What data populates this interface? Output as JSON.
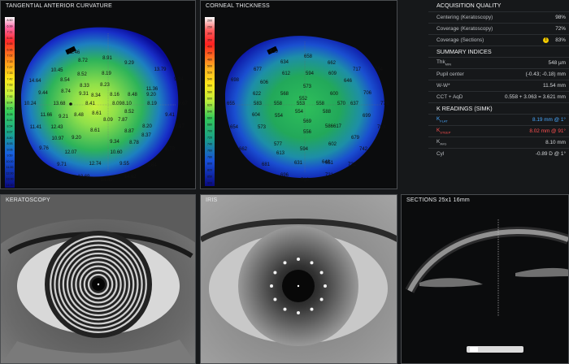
{
  "panels": {
    "tangential": {
      "title": "TANGENTIAL ANTERIOR CURVATURE",
      "scale": [
        "8.50",
        "6.99",
        "7.11",
        "6.44",
        "6.65",
        "6.96",
        "7.02",
        "7.15",
        "7.27",
        "7.33",
        "7.42",
        "7.63",
        "7.79",
        "7.92",
        "8.04",
        "8.15",
        "8.28",
        "8.41",
        "8.54",
        "8.67",
        "8.80",
        "8.93",
        "9.06",
        "9.50",
        "10.00",
        "11.00",
        "12.00",
        "13.00",
        "14.00"
      ],
      "values": [
        {
          "t": "11.46"
        },
        {
          "t": "8.72"
        },
        {
          "t": "8.91"
        },
        {
          "t": "9.29"
        },
        {
          "t": "13.79"
        },
        {
          "t": "10.45"
        },
        {
          "t": "8.54"
        },
        {
          "t": "8.52"
        },
        {
          "t": "8.19"
        },
        {
          "t": "11.36"
        },
        {
          "t": "9.84"
        },
        {
          "t": "14.64"
        },
        {
          "t": "9.44"
        },
        {
          "t": "8.33"
        },
        {
          "t": "8.23"
        },
        {
          "t": "8.74"
        },
        {
          "t": "9.31"
        },
        {
          "t": "8.34"
        },
        {
          "t": "8.16"
        },
        {
          "t": "8.48"
        },
        {
          "t": "9.20"
        },
        {
          "t": "10.24"
        },
        {
          "t": "13.68"
        },
        {
          "t": "8.41"
        },
        {
          "t": "8.09"
        },
        {
          "t": "8.10"
        },
        {
          "t": "8.19"
        },
        {
          "t": "9.67"
        },
        {
          "t": "11.66"
        },
        {
          "t": "9.21"
        },
        {
          "t": "8.61"
        },
        {
          "t": "8.52"
        },
        {
          "t": "9.41"
        },
        {
          "t": "11.41"
        },
        {
          "t": "12.43"
        },
        {
          "t": "8.48"
        },
        {
          "t": "8.09"
        },
        {
          "t": "7.87"
        },
        {
          "t": "8.20"
        },
        {
          "t": "9.17"
        },
        {
          "t": "10.97"
        },
        {
          "t": "9.20"
        },
        {
          "t": "8.61"
        },
        {
          "t": "8.87"
        },
        {
          "t": "8.37"
        },
        {
          "t": "9.76"
        },
        {
          "t": "12.07"
        },
        {
          "t": "9.34"
        },
        {
          "t": "8.78"
        },
        {
          "t": "8.78"
        },
        {
          "t": "10.60"
        },
        {
          "t": "9.71"
        },
        {
          "t": "12.74"
        },
        {
          "t": "9.55"
        },
        {
          "t": "9.64"
        },
        {
          "t": "13.69"
        },
        {
          "t": "14.62"
        },
        {
          "t": "14.42"
        },
        {
          "t": "14.88"
        }
      ]
    },
    "thickness": {
      "title": "CORNEAL THICKNESS",
      "scale": [
        "200",
        "250",
        "300",
        "350",
        "400",
        "450",
        "480",
        "500",
        "520",
        "540",
        "560",
        "580",
        "600",
        "620",
        "640",
        "660",
        "680",
        "700",
        "720",
        "740",
        "760",
        "780",
        "800",
        "820",
        "850",
        "900"
      ],
      "values": [
        {
          "t": "619"
        },
        {
          "t": "658"
        },
        {
          "t": "634"
        },
        {
          "t": "662"
        },
        {
          "t": "717"
        },
        {
          "t": "677"
        },
        {
          "t": "612"
        },
        {
          "t": "594"
        },
        {
          "t": "609"
        },
        {
          "t": "646"
        },
        {
          "t": "754"
        },
        {
          "t": "698"
        },
        {
          "t": "606"
        },
        {
          "t": "573"
        },
        {
          "t": "622"
        },
        {
          "t": "568"
        },
        {
          "t": "552"
        },
        {
          "t": "600"
        },
        {
          "t": "706"
        },
        {
          "t": "655"
        },
        {
          "t": "583"
        },
        {
          "t": "558"
        },
        {
          "t": "553"
        },
        {
          "t": "558"
        },
        {
          "t": "570"
        },
        {
          "t": "637"
        },
        {
          "t": "770"
        },
        {
          "t": "554"
        },
        {
          "t": "588"
        },
        {
          "t": "654"
        },
        {
          "t": "573"
        },
        {
          "t": "554"
        },
        {
          "t": "556"
        },
        {
          "t": "586"
        },
        {
          "t": "699"
        },
        {
          "t": "604"
        },
        {
          "t": "569"
        },
        {
          "t": "617"
        },
        {
          "t": "763"
        },
        {
          "t": "662"
        },
        {
          "t": "577"
        },
        {
          "t": "602"
        },
        {
          "t": "679"
        },
        {
          "t": "613"
        },
        {
          "t": "594"
        },
        {
          "t": "651"
        },
        {
          "t": "742"
        },
        {
          "t": "681"
        },
        {
          "t": "631"
        },
        {
          "t": "648"
        },
        {
          "t": "732"
        },
        {
          "t": "696"
        },
        {
          "t": "716"
        },
        {
          "t": "721"
        }
      ]
    },
    "keratoscopy": {
      "title": "KERATOSCOPY"
    },
    "iris": {
      "title": "IRIS"
    },
    "sections": {
      "title": "SECTIONS 25x1 16mm"
    }
  },
  "acquisition": {
    "title": "ACQUISITION QUALITY",
    "rows": [
      {
        "label": "Centering (Keratoscopy)",
        "value": "98%"
      },
      {
        "label": "Coverage (Keratoscopy)",
        "value": "72%"
      },
      {
        "label": "Coverage (Sections)",
        "value": "83%",
        "warn": "!"
      }
    ]
  },
  "summary": {
    "title": "SUMMARY INDICES",
    "rows": [
      {
        "label": "Thk",
        "sub": "MIN",
        "value": "548 µm"
      },
      {
        "label": "Pupil center",
        "value": "(-0.43; -0.18) mm"
      },
      {
        "label": "W-W*",
        "value": "11.54 mm"
      },
      {
        "label": "CCT + AqD",
        "value": "0.558 + 3.063 = 3.621 mm"
      }
    ]
  },
  "kreadings": {
    "title": "K READINGS (SIMK)",
    "rows": [
      {
        "label": "K",
        "sub": "FLAT",
        "value": "8.19 mm @ 1°",
        "color": "blue"
      },
      {
        "label": "K",
        "sub": "STEEP",
        "value": "8.02 mm @ 91°",
        "color": "red"
      },
      {
        "label": "K",
        "sub": "AVG",
        "value": "8.10 mm",
        "color": ""
      },
      {
        "label": "Cyl",
        "value": "-0.89 D @ 1°",
        "color": ""
      }
    ]
  },
  "colors": {
    "accent_blue": "#4aa9ff",
    "accent_red": "#ff5050",
    "warn_yellow": "#f0c800"
  },
  "icons": {
    "warning": "warning-icon"
  }
}
